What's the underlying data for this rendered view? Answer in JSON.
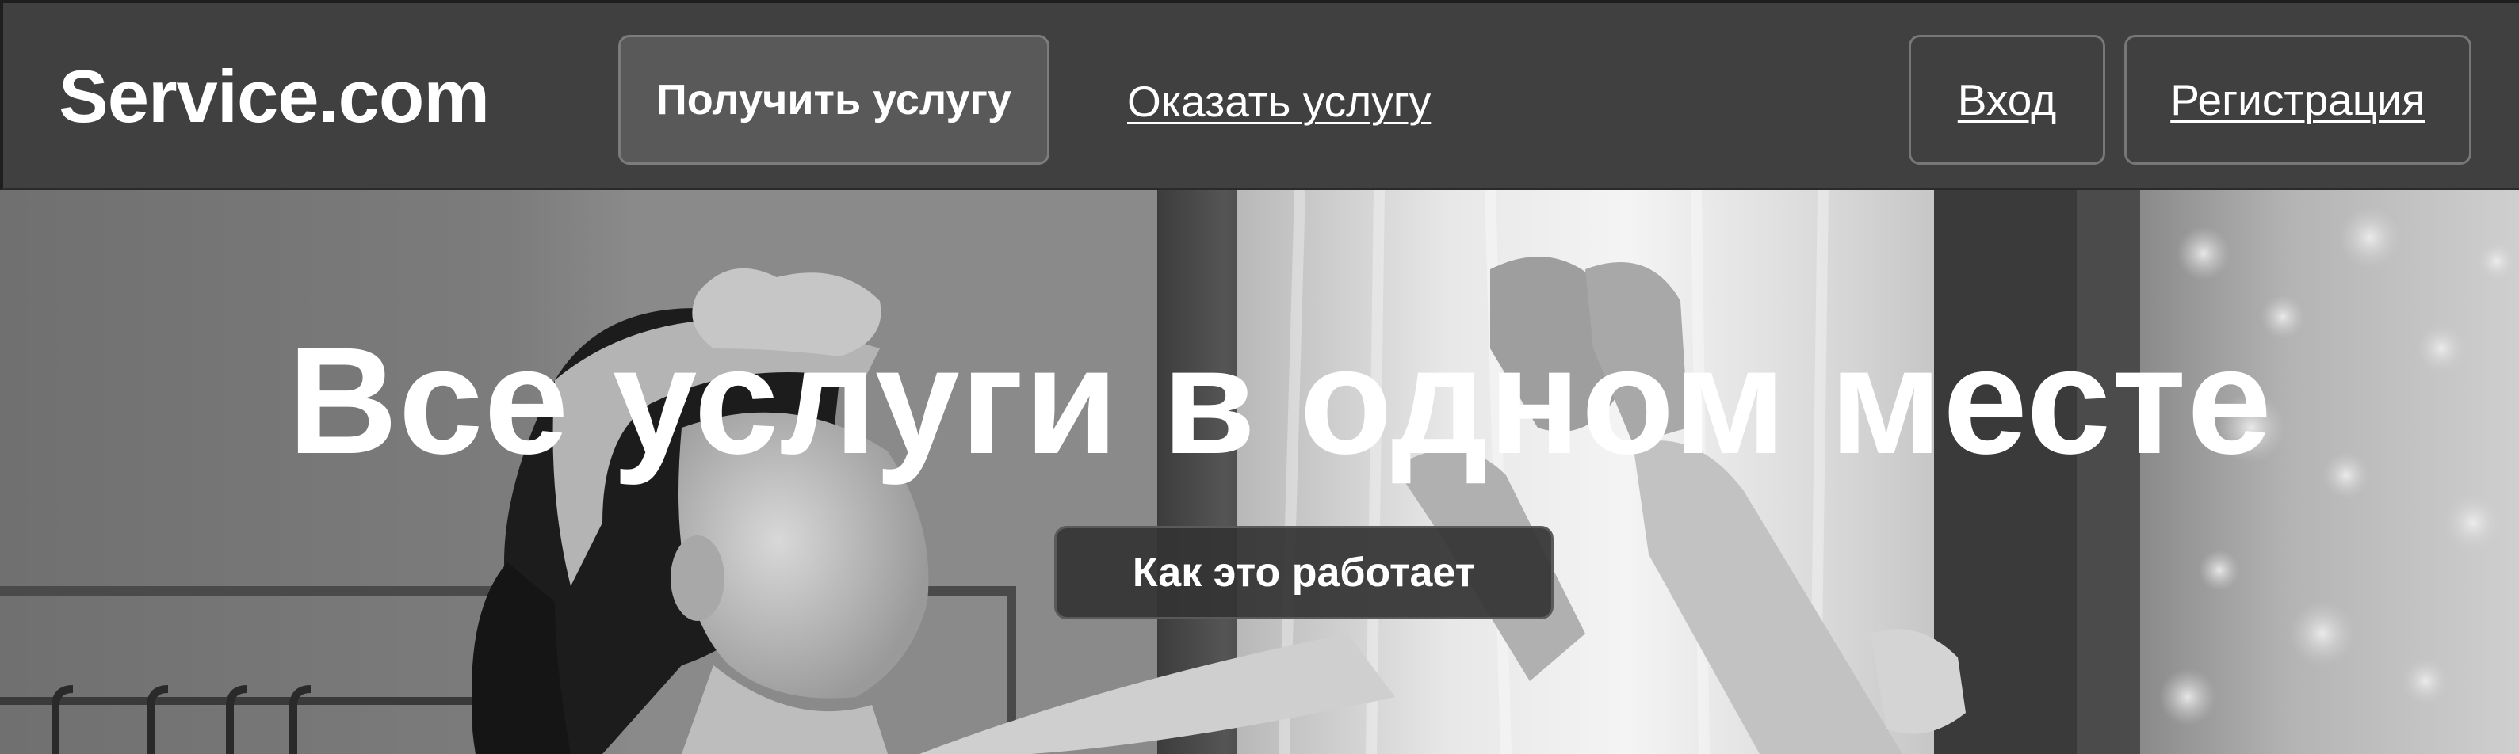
{
  "header": {
    "logo": "Service.com",
    "nav": {
      "get_service": "Получить услугу",
      "offer_service": "Оказать услугу"
    },
    "auth": {
      "login": "Вход",
      "register": "Регистрация"
    }
  },
  "hero": {
    "title": "Все услуги в одном месте",
    "cta": "Как это работает"
  },
  "colors": {
    "header_bg": "#404040",
    "active_button_bg": "#595959",
    "cta_bg": "#343434",
    "text": "#ffffff"
  }
}
